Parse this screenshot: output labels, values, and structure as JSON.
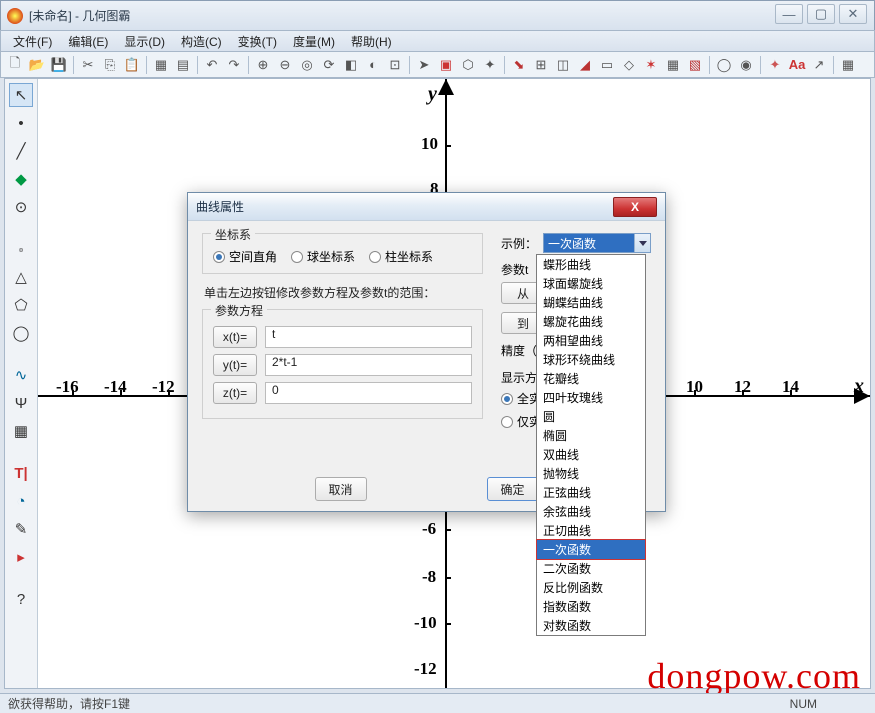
{
  "window": {
    "title": "[未命名] - 几何图霸"
  },
  "menu": {
    "file": "文件(F)",
    "edit": "编辑(E)",
    "view": "显示(D)",
    "construct": "构造(C)",
    "transform": "变换(T)",
    "measure": "度量(M)",
    "help": "帮助(H)"
  },
  "status": {
    "hint": "欲获得帮助，请按F1键",
    "num": "NUM"
  },
  "watermark": "dongpow.com",
  "axes": {
    "xlabel": "x",
    "ylabel": "y",
    "xTicks": [
      "-16",
      "-14",
      "-12",
      "10",
      "12",
      "14"
    ],
    "yTicks": [
      "10",
      "8",
      "-6",
      "-8",
      "-10",
      "-12"
    ]
  },
  "dialog": {
    "title": "曲线属性",
    "coord": {
      "title": "坐标系",
      "rect": "空间直角",
      "sphere": "球坐标系",
      "cyl": "柱坐标系"
    },
    "instruction": "单击左边按钮修改参数方程及参数t的范围：",
    "param": {
      "title": "参数方程",
      "xbtn": "x(t)=",
      "xval": "t",
      "ybtn": "y(t)=",
      "yval": "2*t-1",
      "zbtn": "z(t)=",
      "zval": "0"
    },
    "right": {
      "example": "示例：",
      "selected": "一次函数",
      "paramT": "参数t",
      "from": "从",
      "to": "到",
      "precision": "精度（步",
      "display": "显示方式",
      "solid": "全实线",
      "onlyReal": "仅实线"
    },
    "buttons": {
      "cancel": "取消",
      "ok": "确定"
    }
  },
  "dropdown": {
    "items": [
      "蝶形曲线",
      "球面螺旋线",
      "蝴蝶结曲线",
      "螺旋花曲线",
      "两相望曲线",
      "球形环绕曲线",
      "花瓣线",
      "四叶玫瑰线",
      "圆",
      "椭圆",
      "双曲线",
      "抛物线",
      "正弦曲线",
      "余弦曲线",
      "正切曲线",
      "一次函数",
      "二次函数",
      "反比例函数",
      "指数函数",
      "对数函数"
    ],
    "highlighted": "一次函数"
  }
}
